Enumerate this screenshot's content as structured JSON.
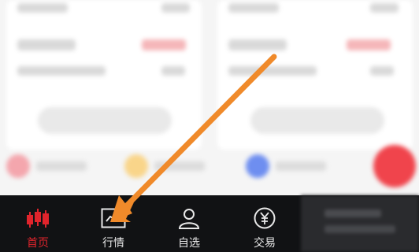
{
  "tabbar": {
    "tabs": [
      {
        "id": "home",
        "label": "首页",
        "icon": "candlestick-icon",
        "active": true
      },
      {
        "id": "market",
        "label": "行情",
        "icon": "line-chart-icon",
        "active": false
      },
      {
        "id": "watchlist",
        "label": "自选",
        "icon": "user-icon",
        "active": false
      },
      {
        "id": "trade",
        "label": "交易",
        "icon": "yuan-coin-icon",
        "active": false
      }
    ]
  },
  "colors": {
    "accent": "#e0242c",
    "arrow": "#f08a2a",
    "tabbar_bg": "#111214"
  }
}
